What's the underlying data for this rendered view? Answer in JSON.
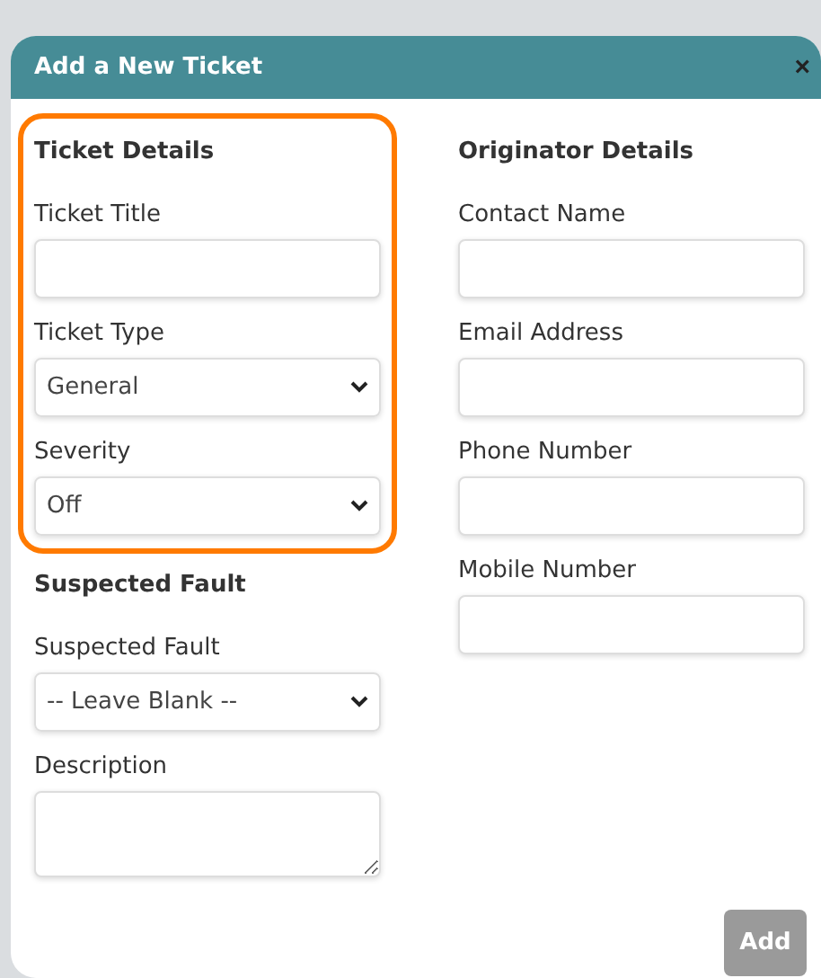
{
  "dialog": {
    "title": "Add a New Ticket",
    "close": "×"
  },
  "columns": [
    {
      "sections": [
        {
          "heading": "Ticket Details",
          "highlighted": true,
          "fields": [
            {
              "label": "Ticket Title",
              "kind": "text"
            },
            {
              "label": "Ticket Type",
              "kind": "select",
              "value": "General"
            },
            {
              "label": "Severity",
              "kind": "select",
              "value": "Off"
            }
          ]
        },
        {
          "heading": "Suspected Fault",
          "highlighted": false,
          "fields": [
            {
              "label": "Suspected Fault",
              "kind": "select",
              "value": "-- Leave Blank --"
            },
            {
              "label": "Description",
              "kind": "textarea"
            }
          ]
        }
      ]
    },
    {
      "sections": [
        {
          "heading": "Originator Details",
          "highlighted": false,
          "fields": [
            {
              "label": "Contact Name",
              "kind": "text"
            },
            {
              "label": "Email Address",
              "kind": "text"
            },
            {
              "label": "Phone Number",
              "kind": "text"
            },
            {
              "label": "Mobile Number",
              "kind": "text"
            }
          ]
        }
      ]
    }
  ],
  "buttons": [
    {
      "label": "Add",
      "disabled": true
    }
  ]
}
